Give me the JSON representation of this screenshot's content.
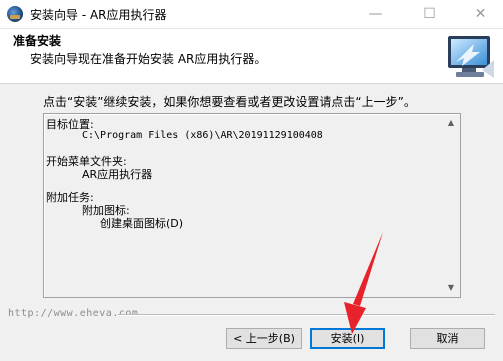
{
  "window": {
    "title": "安装向导 - AR应用执行器",
    "minimize_glyph": "—",
    "maximize_glyph": "☐",
    "close_glyph": "✕"
  },
  "header": {
    "title": "准备安装",
    "subtitle": "安装向导现在准备开始安装 AR应用执行器。"
  },
  "intro": "点击“安装”继续安装，如果你想要查看或者更改设置请点击“上一步”。",
  "summary": {
    "dest_label": "目标位置:",
    "dest_value": "C:\\Program Files (x86)\\AR\\20191129100408",
    "start_menu_label": "开始菜单文件夹:",
    "start_menu_value": "AR应用执行器",
    "tasks_label": "附加任务:",
    "tasks_group": "附加图标:",
    "tasks_item": "创建桌面图标(D)"
  },
  "watermark": "http://www.eheva.com",
  "buttons": {
    "back": "< 上一步(B)",
    "install": "安装(I)",
    "cancel": "取消"
  },
  "colors": {
    "focus_border": "#0078d7",
    "annotation_arrow": "#e8222b"
  },
  "icons": {
    "app": "installer-globe-icon",
    "wizard": "computer-monitor-icon"
  }
}
